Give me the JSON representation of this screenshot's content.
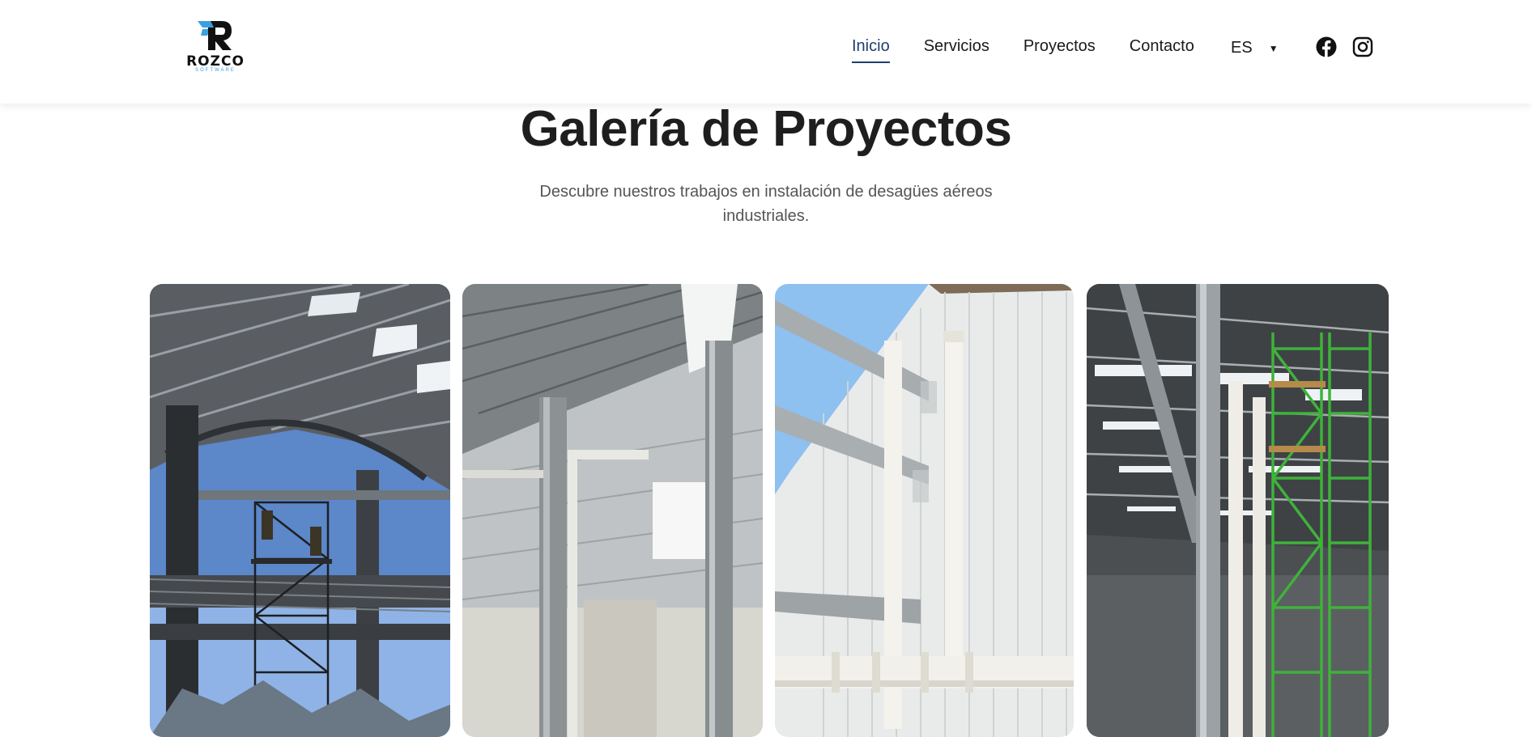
{
  "header": {
    "logo": {
      "name": "ROZCO",
      "sub": "SOFTWARE"
    },
    "nav": [
      {
        "label": "Inicio",
        "active": true
      },
      {
        "label": "Servicios",
        "active": false
      },
      {
        "label": "Proyectos",
        "active": false
      },
      {
        "label": "Contacto",
        "active": false
      }
    ],
    "language": {
      "selected": "ES",
      "icon": "caret-down-icon"
    },
    "social": [
      {
        "icon": "facebook-icon"
      },
      {
        "icon": "instagram-icon"
      }
    ]
  },
  "main": {
    "title": "Galería de Proyectos",
    "subtitle": "Descubre nuestros trabajos en instalación de desagües aéreos industriales."
  },
  "gallery": [
    {
      "kind": "photo"
    },
    {
      "kind": "photo"
    },
    {
      "kind": "photo"
    },
    {
      "kind": "photo"
    }
  ],
  "colors": {
    "accent": "#1f3f6f",
    "logo_blue": "#3aa0e0",
    "text": "#1e1e1e",
    "muted": "#555555"
  }
}
